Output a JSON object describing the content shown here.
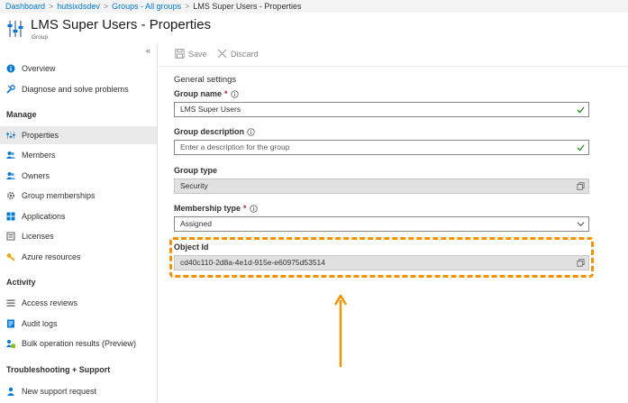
{
  "breadcrumb": {
    "items": [
      "Dashboard",
      "hutsixdsdev",
      "Groups - All groups"
    ],
    "current": "LMS Super Users - Properties"
  },
  "header": {
    "title": "LMS Super Users - Properties",
    "subtitle": "Group"
  },
  "sidebar": {
    "collapse": "«",
    "items_top": [
      "Overview",
      "Diagnose and solve problems"
    ],
    "manage_header": "Manage",
    "manage_items": [
      "Properties",
      "Members",
      "Owners",
      "Group memberships",
      "Applications",
      "Licenses",
      "Azure resources"
    ],
    "activity_header": "Activity",
    "activity_items": [
      "Access reviews",
      "Audit logs",
      "Bulk operation results (Preview)"
    ],
    "support_header": "Troubleshooting + Support",
    "support_items": [
      "New support request"
    ],
    "active_item": "Properties"
  },
  "toolbar": {
    "save_label": "Save",
    "discard_label": "Discard"
  },
  "form": {
    "section_title": "General settings",
    "group_name_label": "Group name",
    "group_name_value": "LMS Super Users",
    "group_description_label": "Group description",
    "group_description_placeholder": "Enter a description for the group",
    "group_type_label": "Group type",
    "group_type_value": "Security",
    "membership_type_label": "Membership type",
    "membership_type_value": "Assigned",
    "object_id_label": "Object Id",
    "object_id_value": "cd40c110-2d8a-4e1d-915e-e60975d53514",
    "required_mark": "*"
  },
  "colors": {
    "accent": "#0078d4",
    "highlight": "#f39200",
    "valid_check": "#107c10",
    "required": "#a4262c"
  }
}
